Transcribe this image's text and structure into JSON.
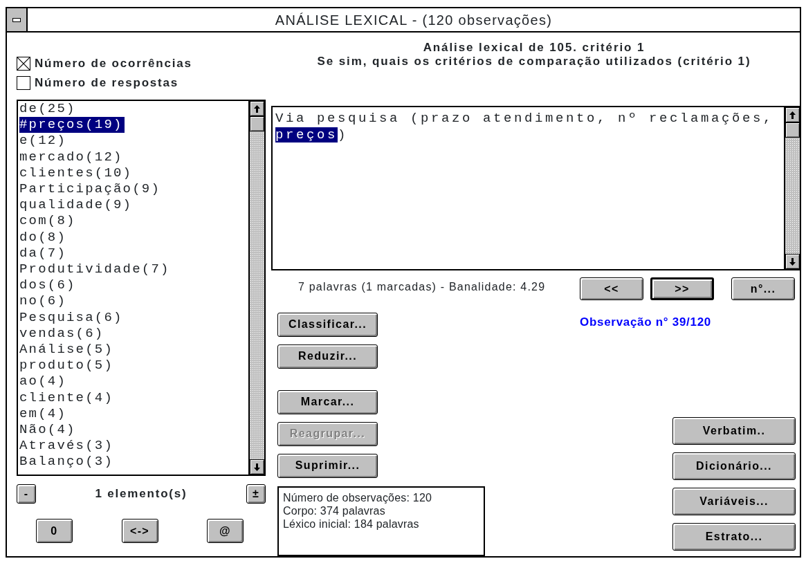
{
  "window": {
    "title": "ANÁLISE LEXICAL - (120 observações)"
  },
  "options": [
    {
      "label": "Número de ocorrências",
      "checked": true
    },
    {
      "label": "Número de respostas",
      "checked": false
    }
  ],
  "header": [
    "Análise lexical de 105. critério 1",
    "Se sim, quais os critérios de comparação utilizados (critério 1)"
  ],
  "word_list": [
    {
      "text": "de(25)",
      "selected": false
    },
    {
      "text": "#preços(19)",
      "selected": true
    },
    {
      "text": "e(12)",
      "selected": false
    },
    {
      "text": "mercado(12)",
      "selected": false
    },
    {
      "text": "clientes(10)",
      "selected": false
    },
    {
      "text": "Participação(9)",
      "selected": false
    },
    {
      "text": "qualidade(9)",
      "selected": false
    },
    {
      "text": "com(8)",
      "selected": false
    },
    {
      "text": "do(8)",
      "selected": false
    },
    {
      "text": "da(7)",
      "selected": false
    },
    {
      "text": "Produtividade(7)",
      "selected": false
    },
    {
      "text": "dos(6)",
      "selected": false
    },
    {
      "text": "no(6)",
      "selected": false
    },
    {
      "text": "Pesquisa(6)",
      "selected": false
    },
    {
      "text": "vendas(6)",
      "selected": false
    },
    {
      "text": "Análise(5)",
      "selected": false
    },
    {
      "text": "produto(5)",
      "selected": false
    },
    {
      "text": "ao(4)",
      "selected": false
    },
    {
      "text": "cliente(4)",
      "selected": false
    },
    {
      "text": "em(4)",
      "selected": false
    },
    {
      "text": "Não(4)",
      "selected": false
    },
    {
      "text": "Através(3)",
      "selected": false
    },
    {
      "text": "Balanço(3)",
      "selected": false
    }
  ],
  "counter": {
    "minus": "-",
    "text": "1 elemento(s)",
    "plus": "±"
  },
  "bottom_buttons": [
    "0",
    "<->",
    "@"
  ],
  "observation_text": [
    {
      "text": "Via pesquisa (prazo atendimento, nº reclamações, ",
      "highlighted": false
    },
    {
      "text": "preços",
      "highlighted": true
    },
    {
      "text": ")",
      "highlighted": false
    }
  ],
  "stats_line": "7 palavras (1 marcadas) - Banalidade: 4.29",
  "nav_buttons": [
    {
      "label": "<<",
      "default": false
    },
    {
      "label": ">>",
      "default": true
    },
    {
      "label": "n°...",
      "default": false
    }
  ],
  "observation_label": "Observação n° 39/120",
  "action_buttons": [
    {
      "label": "Classificar...",
      "disabled": false,
      "gap_before": false
    },
    {
      "label": "Reduzir...",
      "disabled": false,
      "gap_before": false
    },
    {
      "label": "Marcar...",
      "disabled": false,
      "gap_before": true
    },
    {
      "label": "Reagrupar...",
      "disabled": true,
      "gap_before": false
    },
    {
      "label": "Suprimir...",
      "disabled": false,
      "gap_before": false
    }
  ],
  "stats_box": [
    "Número de observações: 120",
    "Corpo: 374 palavras",
    "Léxico inicial: 184 palavras"
  ],
  "side_buttons": [
    "Verbatim..",
    "Dicionário...",
    "Variáveis...",
    "Estrato..."
  ]
}
